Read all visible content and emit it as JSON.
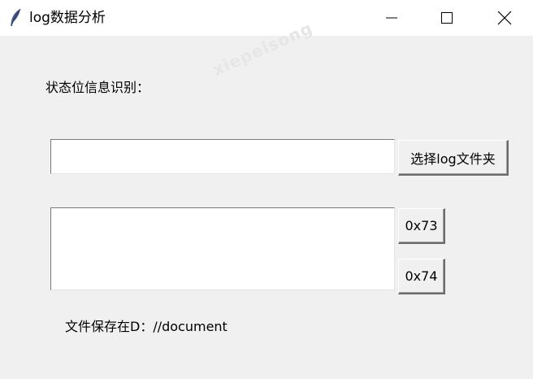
{
  "window": {
    "title": "log数据分析",
    "app_icon": "feather-icon",
    "controls": {
      "minimize_icon": "minimize-icon",
      "maximize_icon": "maximize-icon",
      "close_icon": "close-icon"
    }
  },
  "watermark": "xiepeisong",
  "main": {
    "status_label": "状态位信息识别：",
    "folder_path_value": "",
    "select_folder_button": "选择log文件夹",
    "result_text_value": "",
    "button_0x73": "0x73",
    "button_0x74": "0x74",
    "save_location_label": "文件保存在D：//document"
  },
  "colors": {
    "window_background": "#f0f0f0",
    "titlebar_background": "#ffffff",
    "input_background": "#ffffff",
    "text": "#000000"
  }
}
